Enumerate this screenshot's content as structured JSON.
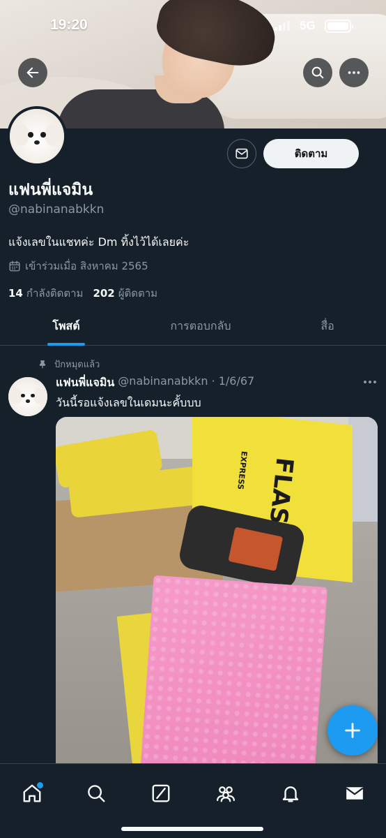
{
  "status_bar": {
    "time": "19:20",
    "network": "5G"
  },
  "profile": {
    "display_name": "แฟนพี่แจมิน",
    "handle": "@nabinanabkkn",
    "bio": "แจ้งเลขในแชทค่ะ Dm ทิ้งไว้ได้เลยค่ะ",
    "joined": "เข้าร่วมเมื่อ สิงหาคม 2565",
    "following_count": "14",
    "following_label": "กำลังติดตาม",
    "followers_count": "202",
    "followers_label": "ผู้ติดตาม",
    "follow_button": "ติดตาม"
  },
  "tabs": [
    {
      "label": "โพสต์",
      "active": true
    },
    {
      "label": "การตอบกลับ",
      "active": false
    },
    {
      "label": "สื่อ",
      "active": false
    }
  ],
  "tweet": {
    "pinned_label": "ปักหมุดแล้ว",
    "author_name": "แฟนพี่แจมิน",
    "author_handle": "@nabinanabkkn",
    "date": "· 1/6/67",
    "text": "วันนี้รอแจ้งเลขในเดมนะคั้บบบ"
  },
  "photo_text": {
    "brand": "FLASH",
    "brand_sub": "EXPRESS"
  },
  "icons": {
    "back": "arrow-left-icon",
    "search": "search-icon",
    "more": "more-horizontal-icon",
    "message": "mail-icon",
    "calendar": "calendar-icon",
    "pin": "pin-icon",
    "compose": "plus-icon",
    "nav": [
      "home-icon",
      "search-icon",
      "grok-icon",
      "communities-icon",
      "bell-icon",
      "mail-icon"
    ]
  },
  "colors": {
    "background": "#15202b",
    "accent": "#1d9bf0",
    "muted": "#8b98a5",
    "text": "#f7f9f9"
  }
}
